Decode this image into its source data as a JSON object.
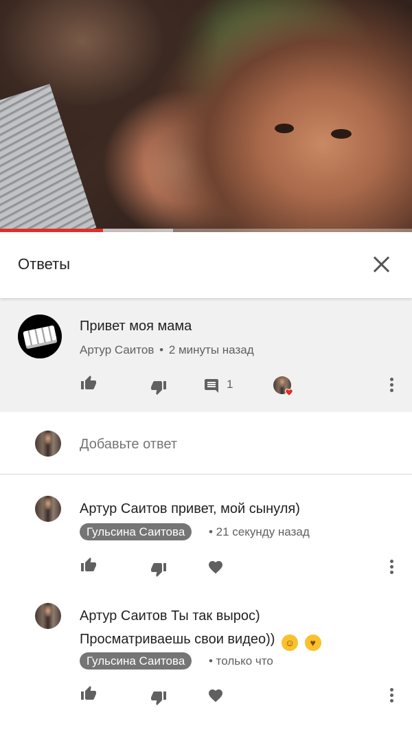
{
  "video": {
    "progress_fraction": 0.25,
    "buffer_fraction": 0.42
  },
  "header": {
    "title": "Ответы"
  },
  "parent_comment": {
    "text": "Привет моя мама",
    "author": "Артур Саитов",
    "separator": "•",
    "time": "2 минуты назад",
    "reply_count": "1"
  },
  "add_reply": {
    "placeholder": "Добавьте ответ"
  },
  "replies": [
    {
      "text_line1": "Артур Саитов привет, мой сынуля)",
      "author": "Гульсина Саитова",
      "time": "• 21 секунду назад"
    },
    {
      "text_line1": "Артур Саитов  Ты так вырос)",
      "text_line2": "Просматриваешь свои видео))",
      "author": "Гульсина Саитова",
      "time": "• только что"
    }
  ],
  "colors": {
    "accent": "#e52d27",
    "chip": "#757575",
    "icon": "#606060"
  }
}
